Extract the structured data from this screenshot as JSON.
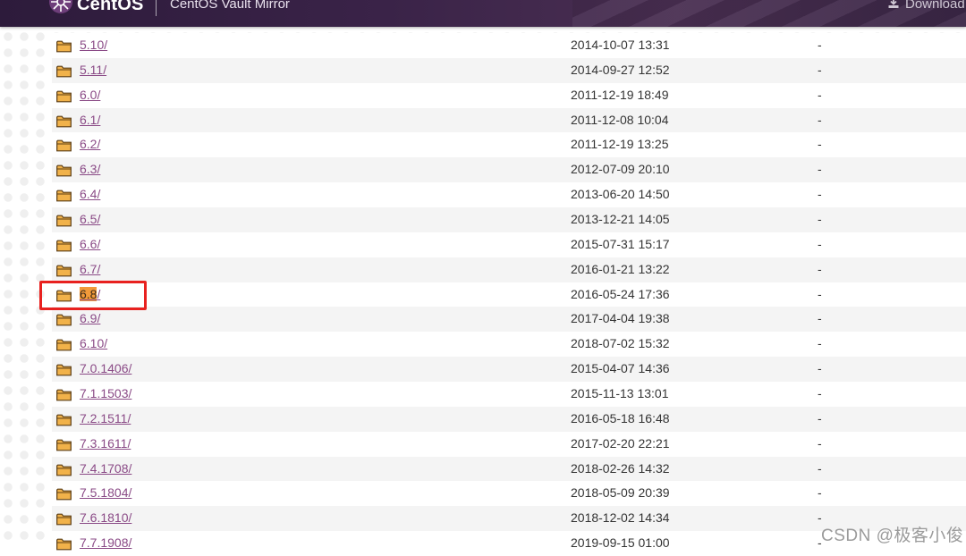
{
  "header": {
    "brand": "CentOS",
    "subtitle": "CentOS Vault Mirror",
    "download_label": "Download"
  },
  "rows": [
    {
      "name": "5.10/",
      "date": "2014-10-07 13:31",
      "size": "-"
    },
    {
      "name": "5.11/",
      "date": "2014-09-27 12:52",
      "size": "-"
    },
    {
      "name": "6.0/",
      "date": "2011-12-19 18:49",
      "size": "-"
    },
    {
      "name": "6.1/",
      "date": "2011-12-08 10:04",
      "size": "-"
    },
    {
      "name": "6.2/",
      "date": "2011-12-19 13:25",
      "size": "-"
    },
    {
      "name": "6.3/",
      "date": "2012-07-09 20:10",
      "size": "-"
    },
    {
      "name": "6.4/",
      "date": "2013-06-20 14:50",
      "size": "-"
    },
    {
      "name": "6.5/",
      "date": "2013-12-21 14:05",
      "size": "-"
    },
    {
      "name": "6.6/",
      "date": "2015-07-31 15:17",
      "size": "-"
    },
    {
      "name": "6.7/",
      "date": "2016-01-21 13:22",
      "size": "-"
    },
    {
      "name": "6.8/",
      "date": "2016-05-24 17:36",
      "size": "-",
      "highlight": "6.8"
    },
    {
      "name": "6.9/",
      "date": "2017-04-04 19:38",
      "size": "-"
    },
    {
      "name": "6.10/",
      "date": "2018-07-02 15:32",
      "size": "-"
    },
    {
      "name": "7.0.1406/",
      "date": "2015-04-07 14:36",
      "size": "-"
    },
    {
      "name": "7.1.1503/",
      "date": "2015-11-13 13:01",
      "size": "-"
    },
    {
      "name": "7.2.1511/",
      "date": "2016-05-18 16:48",
      "size": "-"
    },
    {
      "name": "7.3.1611/",
      "date": "2017-02-20 22:21",
      "size": "-"
    },
    {
      "name": "7.4.1708/",
      "date": "2018-02-26 14:32",
      "size": "-"
    },
    {
      "name": "7.5.1804/",
      "date": "2018-05-09 20:39",
      "size": "-"
    },
    {
      "name": "7.6.1810/",
      "date": "2018-12-02 14:34",
      "size": "-"
    },
    {
      "name": "7.7.1908/",
      "date": "2019-09-15 01:00",
      "size": "-"
    }
  ],
  "watermark": "CSDN @极客小俊",
  "colors": {
    "header_bg": "#3a2348",
    "link": "#8a4a86",
    "highlight": "#f29a3a",
    "callout": "#e8211f",
    "folder": "#f1b24a"
  },
  "icons": {
    "logo": "centos-logo-icon",
    "download": "download-icon",
    "folder": "folder-icon"
  }
}
